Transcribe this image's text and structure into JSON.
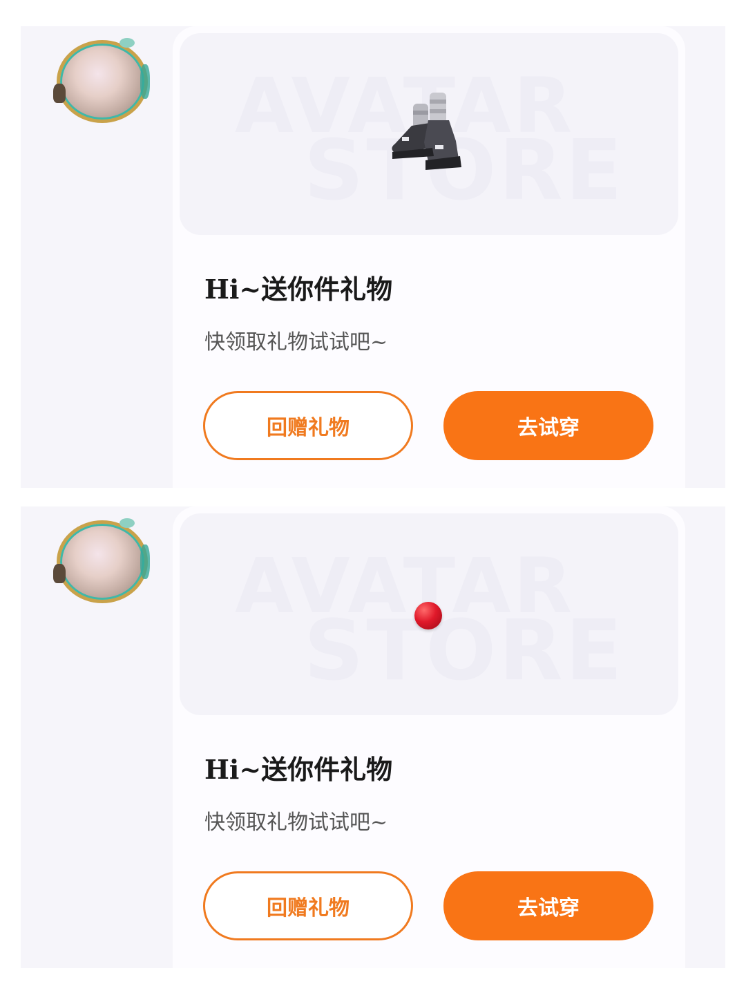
{
  "messages": [
    {
      "title": "Hi~送你件礼物",
      "subtitle": "快领取礼物试试吧~",
      "gift_button": "回赠礼物",
      "try_button": "去试穿",
      "watermark_line1": "AVATAR",
      "watermark_line2": "STORE",
      "item_icon": "shoes-icon"
    },
    {
      "title": "Hi~送你件礼物",
      "subtitle": "快领取礼物试试吧~",
      "gift_button": "回赠礼物",
      "try_button": "去试穿",
      "watermark_line1": "AVATAR",
      "watermark_line2": "STORE",
      "item_icon": "red-ball-icon"
    }
  ],
  "colors": {
    "accent": "#f97415",
    "panel_bg": "#f6f5fa",
    "card_bg": "#fdfcff"
  }
}
